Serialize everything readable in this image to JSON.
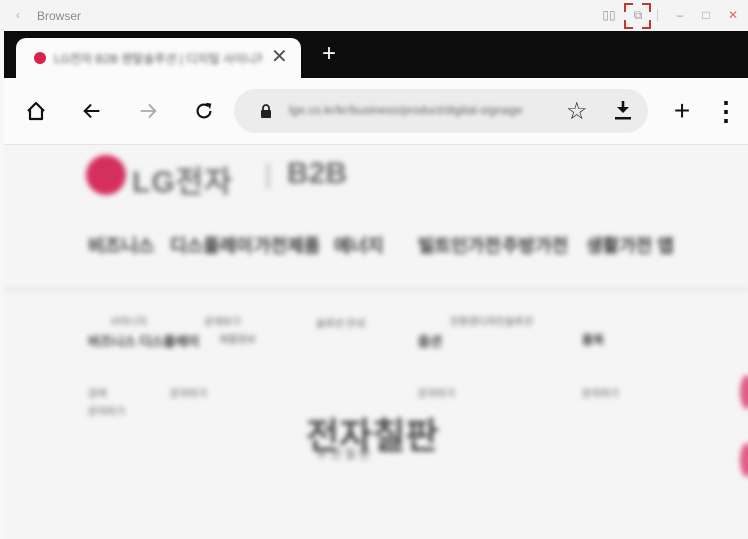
{
  "window": {
    "back_glyph": "‹",
    "title": "Browser",
    "controls": {
      "split": "▯▯",
      "pip": "⧉",
      "minimize": "–",
      "maximize": "□",
      "close": "✕"
    }
  },
  "tab": {
    "title": "LG전자 B2B 렌탈솔루션 | 디지털 사이니지",
    "close": "✕",
    "new_tab": "+"
  },
  "toolbar": {
    "home": "⌂",
    "back": "←",
    "forward": "→",
    "reload": "↻",
    "url": "lge.co.kr/kr/business/product/digital-signage",
    "star": "☆",
    "add": "+",
    "menu": "⋮"
  },
  "page": {
    "logo_text": "LG전자",
    "logo_suffix": "B2B",
    "nav_items": [
      "비즈니스",
      "디스플레이",
      "가전제품",
      "에너지",
      "빌트인가전",
      "주방가전",
      "생활가전 앱"
    ],
    "small": [
      "사이니지",
      "비즈니스 디스플레이",
      "상세보기",
      "제품정보",
      "솔루션 안내",
      "친환경디자인솔루션",
      "옵션",
      "품목",
      "검색",
      "문의하기",
      "문의하기",
      "문의하기",
      "문의하기",
      "문의하기"
    ],
    "big_text": "전자칠판",
    "big_sub": "무 선 칠 판"
  },
  "colors": {
    "accent": "#c0392b",
    "lg_red": "#d52f5e",
    "tab_dark": "#0c0c0c"
  }
}
